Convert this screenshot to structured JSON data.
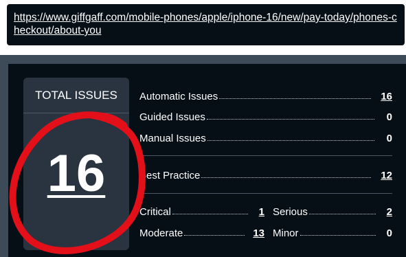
{
  "url": {
    "text": "https://www.giffgaff.com/mobile-phones/apple/iphone-16/new/pay-today/phones-checkout/about-you"
  },
  "total": {
    "heading": "TOTAL ISSUES",
    "count": "16"
  },
  "issues": [
    {
      "label": "Automatic Issues",
      "value": "16"
    },
    {
      "label": "Guided Issues",
      "value": "0"
    },
    {
      "label": "Manual Issues",
      "value": "0"
    }
  ],
  "best_practice": {
    "label": "Best Practice",
    "value": "12"
  },
  "severity": {
    "critical": {
      "label": "Critical",
      "value": "1"
    },
    "serious": {
      "label": "Serious",
      "value": "2"
    },
    "moderate": {
      "label": "Moderate",
      "value": "13"
    },
    "minor": {
      "label": "Minor",
      "value": "0"
    }
  },
  "colors": {
    "panel_background": "#060e16",
    "total_box_background": "#2a3440",
    "annotation_circle": "#e3101a"
  }
}
